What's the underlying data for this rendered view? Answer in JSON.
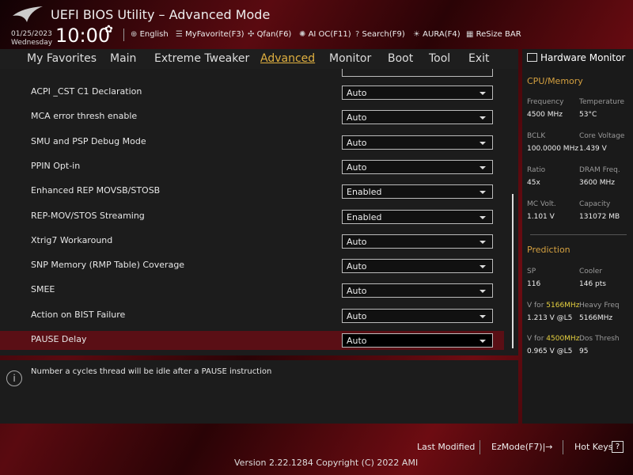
{
  "header": {
    "title": "UEFI BIOS Utility – Advanced Mode",
    "date": "01/25/2023",
    "day": "Wednesday",
    "time": "10:00",
    "toolbar": [
      {
        "label": "English",
        "icon": "globe-icon"
      },
      {
        "label": "MyFavorite(F3)",
        "icon": "favorite-icon"
      },
      {
        "label": "Qfan(F6)",
        "icon": "fan-icon"
      },
      {
        "label": "AI OC(F11)",
        "icon": "ai-oc-icon"
      },
      {
        "label": "Search(F9)",
        "icon": "search-icon"
      },
      {
        "label": "AURA(F4)",
        "icon": "aura-icon"
      },
      {
        "label": "ReSize BAR",
        "icon": "resize-bar-icon"
      }
    ]
  },
  "nav": {
    "tabs": [
      "My Favorites",
      "Main",
      "Extreme Tweaker",
      "Advanced",
      "Monitor",
      "Boot",
      "Tool",
      "Exit"
    ],
    "active": "Advanced"
  },
  "settings": [
    {
      "label": "ACPI _CST C1 Declaration",
      "value": "Auto"
    },
    {
      "label": "MCA error thresh enable",
      "value": "Auto"
    },
    {
      "label": "SMU and PSP Debug Mode",
      "value": "Auto"
    },
    {
      "label": "PPIN Opt-in",
      "value": "Auto"
    },
    {
      "label": "Enhanced REP MOVSB/STOSB",
      "value": "Enabled"
    },
    {
      "label": "REP-MOV/STOS Streaming",
      "value": "Enabled"
    },
    {
      "label": "Xtrig7 Workaround",
      "value": "Auto"
    },
    {
      "label": "SNP Memory (RMP Table) Coverage",
      "value": "Auto"
    },
    {
      "label": "SMEE",
      "value": "Auto"
    },
    {
      "label": "Action on BIST Failure",
      "value": "Auto"
    },
    {
      "label": "PAUSE Delay",
      "value": "Auto"
    }
  ],
  "description": "Number a cycles thread will be idle after a PAUSE instruction",
  "hw": {
    "title": "Hardware Monitor",
    "cpu_title": "CPU/Memory",
    "cpu": [
      [
        "Frequency",
        "4500 MHz",
        "Temperature",
        "53°C"
      ],
      [
        "BCLK",
        "100.0000 MHz",
        "Core Voltage",
        "1.439 V"
      ],
      [
        "Ratio",
        "45x",
        "DRAM Freq.",
        "3600 MHz"
      ],
      [
        "MC Volt.",
        "1.101 V",
        "Capacity",
        "131072 MB"
      ]
    ],
    "pred_title": "Prediction",
    "sp_k": "SP",
    "sp_v": "116",
    "cooler_k": "Cooler",
    "cooler_v": "146 pts",
    "vfor": "V for ",
    "f1": "5166MHz",
    "v1": "1.213 V @L5",
    "hf_k": "Heavy Freq",
    "hf_v": "5166MHz",
    "f2": "4500MHz",
    "v2": "0.965 V @L5",
    "dt_k": "Dos Thresh",
    "dt_v": "95"
  },
  "footer": {
    "last_modified": "Last Modified",
    "ezmode": "EzMode(F7)|→",
    "hotkeys": "Hot Keys",
    "hotkeys_icon": "?",
    "version": "Version 2.22.1284 Copyright (C) 2022 AMI"
  }
}
